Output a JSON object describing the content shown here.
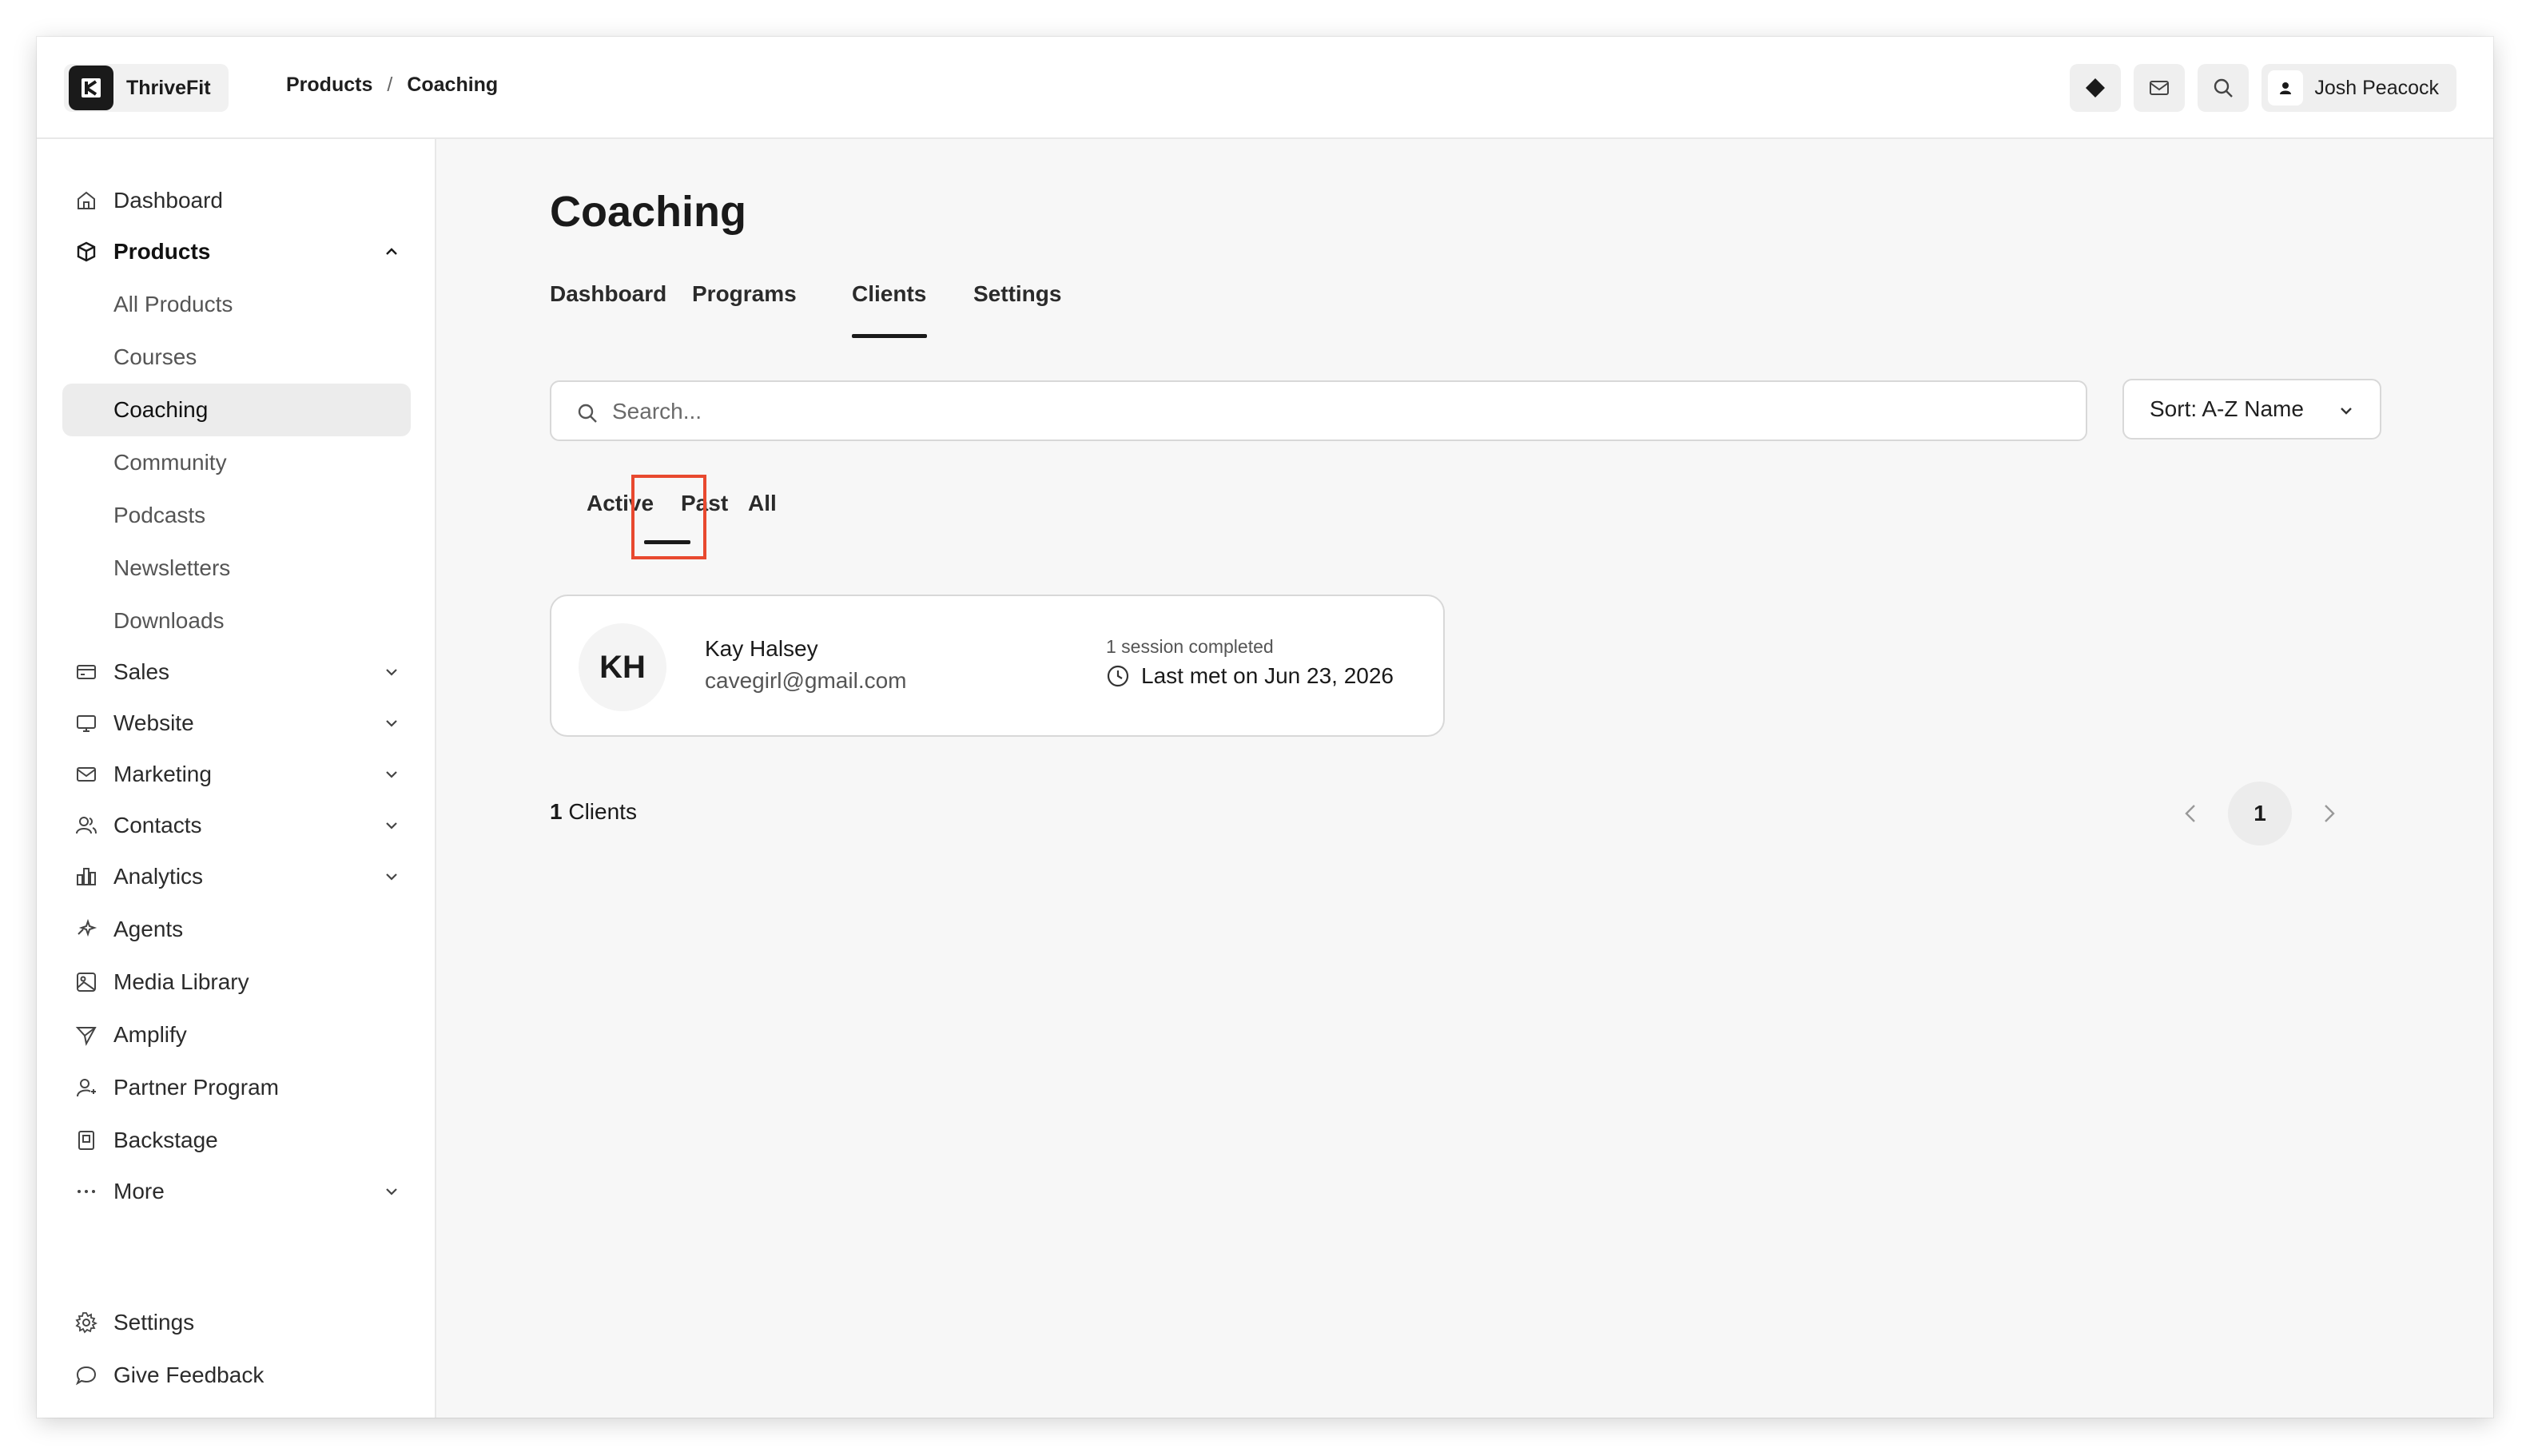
{
  "app": {
    "name": "ThriveFit"
  },
  "breadcrumb": {
    "items": [
      "Products",
      "Coaching"
    ],
    "separator": "/"
  },
  "topbar": {
    "user_name": "Josh Peacock"
  },
  "sidebar": {
    "items": [
      {
        "label": "Dashboard",
        "icon": "home-icon"
      },
      {
        "label": "Products",
        "icon": "box-icon",
        "expanded": true
      },
      {
        "label": "Sales",
        "icon": "card-icon"
      },
      {
        "label": "Website",
        "icon": "monitor-icon"
      },
      {
        "label": "Marketing",
        "icon": "mail-icon"
      },
      {
        "label": "Contacts",
        "icon": "users-icon"
      },
      {
        "label": "Analytics",
        "icon": "chart-icon"
      },
      {
        "label": "Agents",
        "icon": "sparkle-icon"
      },
      {
        "label": "Media Library",
        "icon": "image-icon"
      },
      {
        "label": "Amplify",
        "icon": "send-icon"
      },
      {
        "label": "Partner Program",
        "icon": "partner-icon"
      },
      {
        "label": "Backstage",
        "icon": "backstage-icon"
      },
      {
        "label": "More",
        "icon": "more-icon"
      }
    ],
    "product_subitems": [
      "All Products",
      "Courses",
      "Coaching",
      "Community",
      "Podcasts",
      "Newsletters",
      "Downloads"
    ],
    "active_subitem": "Coaching",
    "footer": [
      {
        "label": "Settings",
        "icon": "gear-icon"
      },
      {
        "label": "Give Feedback",
        "icon": "chat-icon"
      }
    ]
  },
  "main": {
    "title": "Coaching",
    "tabs": [
      "Dashboard",
      "Programs",
      "Clients",
      "Settings"
    ],
    "active_tab": "Clients",
    "search": {
      "placeholder": "Search..."
    },
    "sort": {
      "label": "Sort: A-Z Name"
    },
    "filter_tabs": [
      "Active",
      "Past",
      "All"
    ],
    "active_filter": "Past",
    "clients": [
      {
        "initials": "KH",
        "name": "Kay Halsey",
        "email": "cavegirl@gmail.com",
        "sessions": "1 session completed",
        "last_met": "Last met on Jun 23, 2026"
      }
    ],
    "count": {
      "number": "1",
      "label": "Clients"
    },
    "pagination": {
      "current": "1"
    }
  },
  "colors": {
    "accent": "#1a1a1a",
    "highlight": "#e8492f",
    "background": "#f7f7f7"
  }
}
